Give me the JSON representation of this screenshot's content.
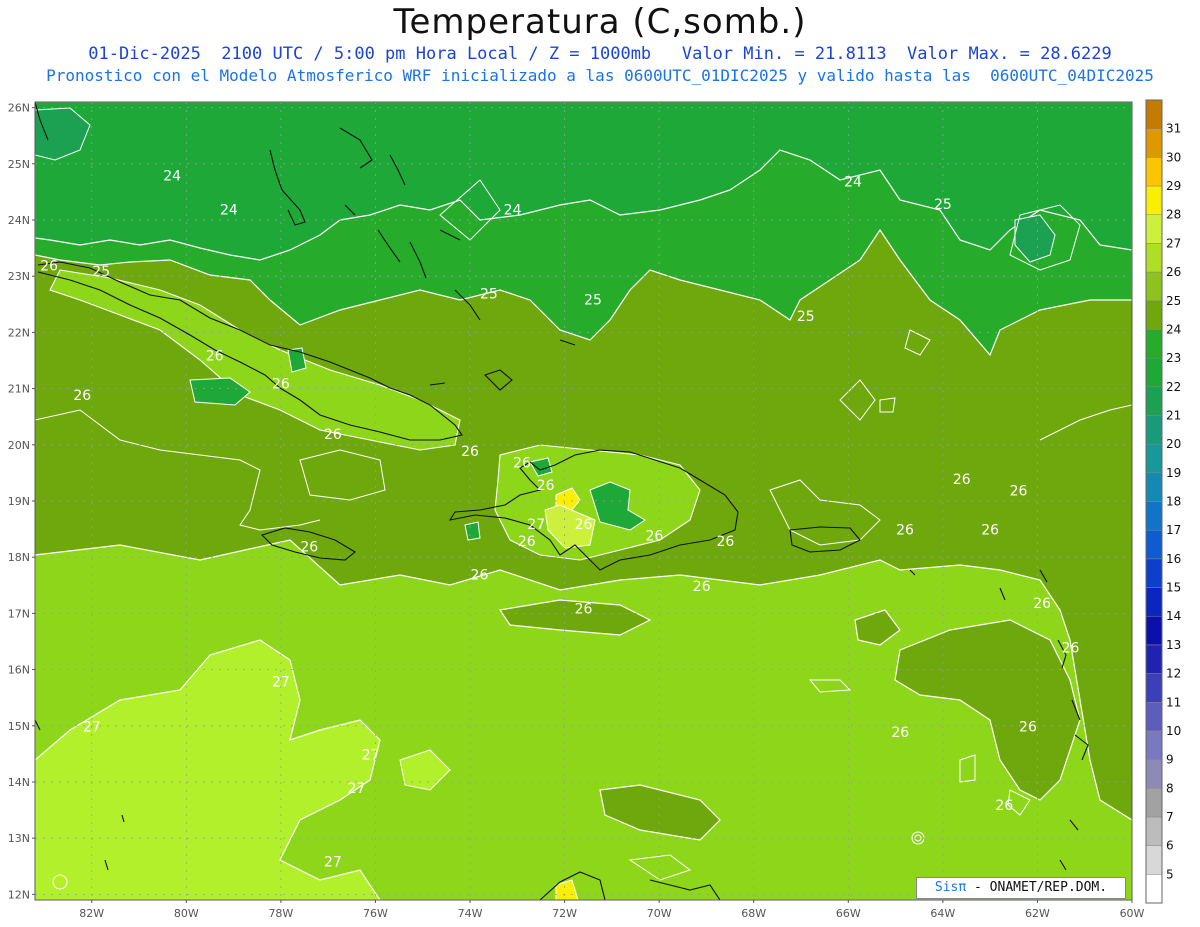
{
  "header": {
    "title": "Temperatura (C,somb.)",
    "line1": "01-Dic-2025  2100 UTC / 5:00 pm Hora Local / Z = 1000mb   Valor Min. = 21.8113  Valor Max. = 28.6229",
    "line2": "Pronostico con el Modelo Atmosferico WRF inicializado a las 0600UTC_01DIC2025 y valido hasta las  0600UTC_04DIC2025"
  },
  "map": {
    "lat_labels": [
      "26N",
      "25N",
      "24N",
      "23N",
      "22N",
      "21N",
      "20N",
      "19N",
      "18N",
      "17N",
      "16N",
      "15N",
      "14N",
      "13N",
      "12N"
    ],
    "lon_labels": [
      "82W",
      "80W",
      "78W",
      "76W",
      "74W",
      "72W",
      "70W",
      "68W",
      "66W",
      "64W",
      "62W",
      "60W"
    ],
    "contour_labels": [
      {
        "text": "24",
        "lon": -80.3,
        "lat": 24.7
      },
      {
        "text": "24",
        "lon": -79.1,
        "lat": 24.1
      },
      {
        "text": "24",
        "lon": -73.1,
        "lat": 24.1
      },
      {
        "text": "24",
        "lon": -65.9,
        "lat": 24.6
      },
      {
        "text": "25",
        "lon": -81.8,
        "lat": 23.0
      },
      {
        "text": "25",
        "lon": -73.6,
        "lat": 22.6
      },
      {
        "text": "25",
        "lon": -71.4,
        "lat": 22.5
      },
      {
        "text": "25",
        "lon": -66.9,
        "lat": 22.2
      },
      {
        "text": "25",
        "lon": -64.0,
        "lat": 24.2
      },
      {
        "text": "26",
        "lon": -82.9,
        "lat": 23.1
      },
      {
        "text": "26",
        "lon": -79.4,
        "lat": 21.5
      },
      {
        "text": "26",
        "lon": -78.0,
        "lat": 21.0
      },
      {
        "text": "26",
        "lon": -82.2,
        "lat": 20.8
      },
      {
        "text": "26",
        "lon": -76.9,
        "lat": 20.1
      },
      {
        "text": "26",
        "lon": -74.0,
        "lat": 19.8
      },
      {
        "text": "26",
        "lon": -72.9,
        "lat": 19.6
      },
      {
        "text": "26",
        "lon": -72.4,
        "lat": 19.2
      },
      {
        "text": "26",
        "lon": -71.6,
        "lat": 18.5
      },
      {
        "text": "26",
        "lon": -72.8,
        "lat": 18.2
      },
      {
        "text": "26",
        "lon": -70.1,
        "lat": 18.3
      },
      {
        "text": "26",
        "lon": -68.6,
        "lat": 18.2
      },
      {
        "text": "26",
        "lon": -77.4,
        "lat": 18.1
      },
      {
        "text": "26",
        "lon": -73.8,
        "lat": 17.6
      },
      {
        "text": "26",
        "lon": -71.6,
        "lat": 17.0
      },
      {
        "text": "26",
        "lon": -69.1,
        "lat": 17.4
      },
      {
        "text": "26",
        "lon": -63.6,
        "lat": 19.3
      },
      {
        "text": "26",
        "lon": -62.4,
        "lat": 19.1
      },
      {
        "text": "26",
        "lon": -64.8,
        "lat": 18.4
      },
      {
        "text": "26",
        "lon": -63.0,
        "lat": 18.4
      },
      {
        "text": "26",
        "lon": -61.9,
        "lat": 17.1
      },
      {
        "text": "26",
        "lon": -61.3,
        "lat": 16.3
      },
      {
        "text": "26",
        "lon": -64.9,
        "lat": 14.8
      },
      {
        "text": "26",
        "lon": -62.2,
        "lat": 14.9
      },
      {
        "text": "26",
        "lon": -62.7,
        "lat": 13.5
      },
      {
        "text": "27",
        "lon": -78.0,
        "lat": 15.7
      },
      {
        "text": "27",
        "lon": -82.0,
        "lat": 14.9
      },
      {
        "text": "27",
        "lon": -76.1,
        "lat": 14.4
      },
      {
        "text": "27",
        "lon": -76.4,
        "lat": 13.8
      },
      {
        "text": "27",
        "lon": -76.9,
        "lat": 12.5
      },
      {
        "text": "27",
        "lon": -72.6,
        "lat": 18.5
      }
    ]
  },
  "colorbar": {
    "levels": [
      "5",
      "6",
      "7",
      "8",
      "9",
      "10",
      "11",
      "12",
      "13",
      "14",
      "15",
      "16",
      "17",
      "18",
      "19",
      "20",
      "21",
      "22",
      "23",
      "24",
      "25",
      "26",
      "27",
      "28",
      "29",
      "30",
      "31"
    ],
    "colors": [
      "#ffffff",
      "#d8d8d8",
      "#bcbcbc",
      "#a2a2a2",
      "#8e8ab8",
      "#7a78c0",
      "#5c5ebc",
      "#3c40b8",
      "#1f23b0",
      "#0a10aa",
      "#0a26c0",
      "#0c40cc",
      "#0f5cd0",
      "#1274c8",
      "#1489b4",
      "#17989a",
      "#199a78",
      "#1ca052",
      "#1ea838",
      "#26ac2a",
      "#6fa80c",
      "#8ec21e",
      "#aede26",
      "#ccf03c",
      "#f8f000",
      "#ffc400",
      "#e09800",
      "#c47c00"
    ]
  },
  "credit": {
    "brand": "Sisπ",
    "text": " - ONAMET/REP.DOM."
  }
}
